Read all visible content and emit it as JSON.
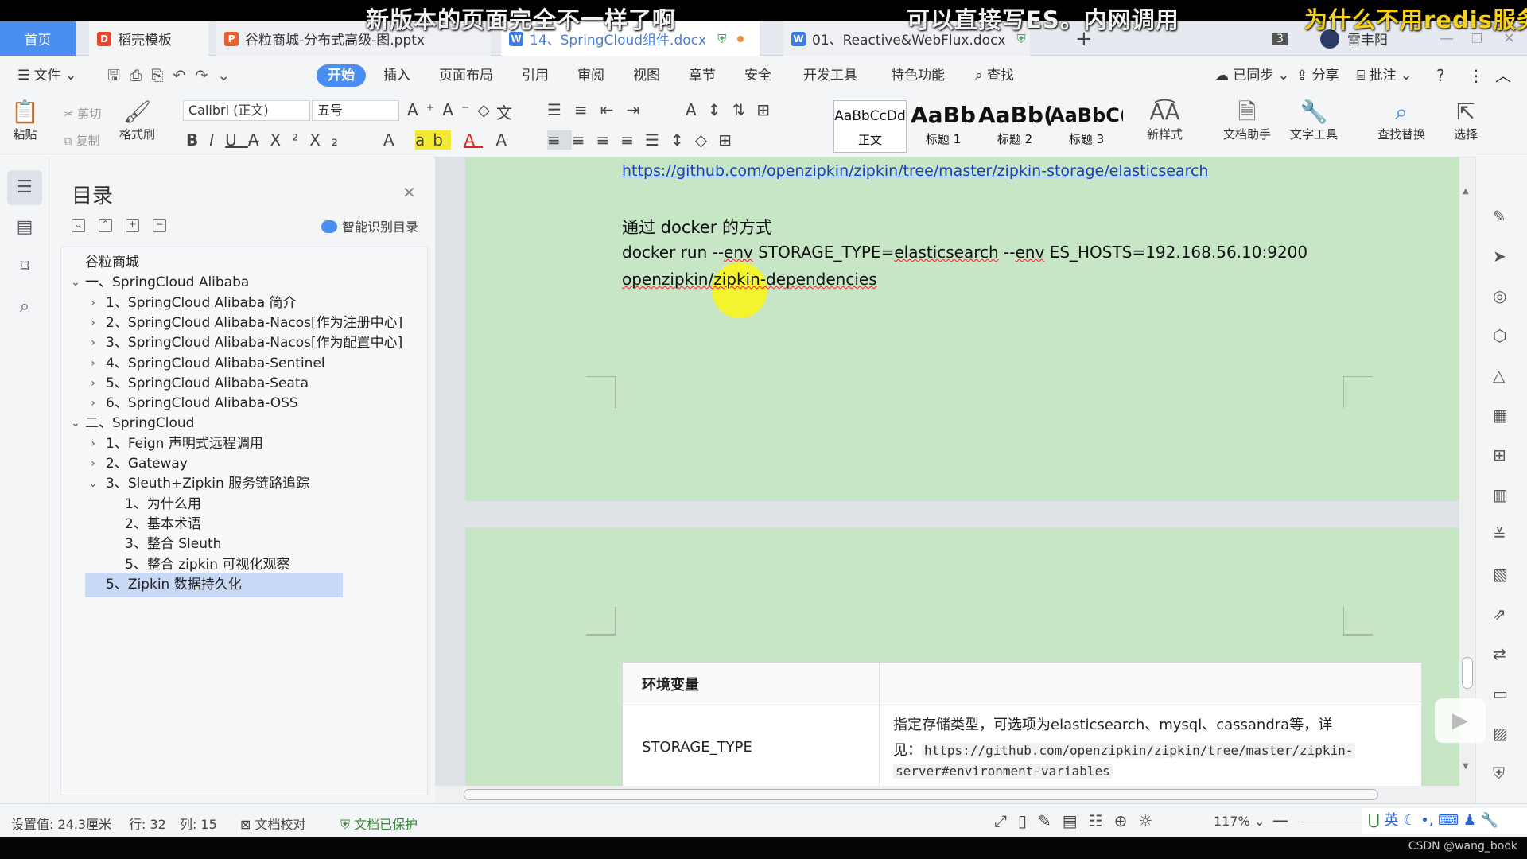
{
  "overlays": {
    "left": "新版本的页面完全不一样了啊",
    "mid": "可以直接写ES。内网调用",
    "right": "为什么不用redis服务"
  },
  "tabs": {
    "home": "首页",
    "daoke": "稻壳模板",
    "pptx": "谷粒商城-分布式高级-图.pptx",
    "docx14": "14、SpringCloud组件.docx",
    "webflux": "01、Reactive&WebFlux.docx",
    "add": "+",
    "count": "3",
    "user": "雷丰阳"
  },
  "menu": {
    "file": "文件",
    "start": "开始",
    "insert": "插入",
    "layout": "页面布局",
    "reference": "引用",
    "review": "审阅",
    "view": "视图",
    "chapter": "章节",
    "security": "安全",
    "devtools": "开发工具",
    "features": "特色功能",
    "search": "查找",
    "synced": "已同步",
    "share": "分享",
    "comment": "批注"
  },
  "ribbon": {
    "paste": "粘贴",
    "cut": "剪切",
    "copy": "复制",
    "format_painter": "格式刷",
    "font": "Calibri (正文)",
    "size": "五号",
    "styles": [
      {
        "preview": "AaBbCcDd",
        "label": "正文"
      },
      {
        "preview": "AaBb",
        "label": "标题 1"
      },
      {
        "preview": "AaBb(",
        "label": "标题 2"
      },
      {
        "preview": "AaBbC(",
        "label": "标题 3"
      }
    ],
    "new_style": "新样式",
    "doc_assistant": "文档助手",
    "text_tools": "文字工具",
    "find_replace": "查找替换",
    "select": "选择"
  },
  "toc": {
    "title": "目录",
    "smart": "智能识别目录",
    "items": [
      {
        "text": "谷粒商城",
        "level": 0,
        "chevron": ""
      },
      {
        "text": "一、SpringCloud Alibaba",
        "level": 0,
        "chevron": "v"
      },
      {
        "text": "1、SpringCloud Alibaba 简介",
        "level": 1,
        "chevron": ">"
      },
      {
        "text": "2、SpringCloud Alibaba-Nacos[作为注册中心]",
        "level": 1,
        "chevron": ">"
      },
      {
        "text": "3、SpringCloud Alibaba-Nacos[作为配置中心]",
        "level": 1,
        "chevron": ">"
      },
      {
        "text": "4、SpringCloud Alibaba-Sentinel",
        "level": 1,
        "chevron": ">"
      },
      {
        "text": "5、SpringCloud Alibaba-Seata",
        "level": 1,
        "chevron": ">"
      },
      {
        "text": "6、SpringCloud Alibaba-OSS",
        "level": 1,
        "chevron": ">"
      },
      {
        "text": "二、SpringCloud",
        "level": 0,
        "chevron": "v"
      },
      {
        "text": "1、Feign 声明式远程调用",
        "level": 1,
        "chevron": ">"
      },
      {
        "text": "2、Gateway",
        "level": 1,
        "chevron": ">"
      },
      {
        "text": "3、Sleuth+Zipkin 服务链路追踪",
        "level": 1,
        "chevron": "v"
      },
      {
        "text": "1、为什么用",
        "level": 2,
        "chevron": ""
      },
      {
        "text": "2、基本术语",
        "level": 2,
        "chevron": ""
      },
      {
        "text": "3、整合 Sleuth",
        "level": 2,
        "chevron": ""
      },
      {
        "text": "5、整合 zipkin 可视化观察",
        "level": 2,
        "chevron": ""
      },
      {
        "text": "5、Zipkin 数据持久化",
        "level": 2,
        "chevron": "",
        "active": true
      }
    ]
  },
  "doc": {
    "link": "https://github.com/openzipkin/zipkin/tree/master/zipkin-storage/elasticsearch",
    "heading": "通过 docker 的方式",
    "cmd1_a": "docker run --",
    "cmd1_b": "env",
    "cmd1_c": " STORAGE_TYPE=",
    "cmd1_d": "elasticsearch",
    "cmd1_e": " --",
    "cmd1_f": "env",
    "cmd1_g": " ES_HOSTS=192.168.56.10:9200",
    "cmd2": "openzipkin/zipkin-dependencies",
    "table": {
      "header": "环境变量",
      "key": "STORAGE_TYPE",
      "desc": "指定存储类型，可选项为elasticsearch、mysql、cassandra等，详",
      "desc2_prefix": "见：",
      "desc2_code": "https://github.com/openzipkin/zipkin/tree/master/zipkin-",
      "desc3_code": "server#environment-variables"
    }
  },
  "status": {
    "setting": "设置值: 24.3厘米",
    "row": "行: 32",
    "col": "列: 15",
    "proof": "文档校对",
    "protected": "文档已保护",
    "zoom": "117%",
    "ime": "英"
  },
  "watermark": "CSDN @wang_book",
  "colors": {
    "accent": "#4a8ef2",
    "page_bg": "#c6e6c6",
    "link": "#1a3cc7"
  }
}
